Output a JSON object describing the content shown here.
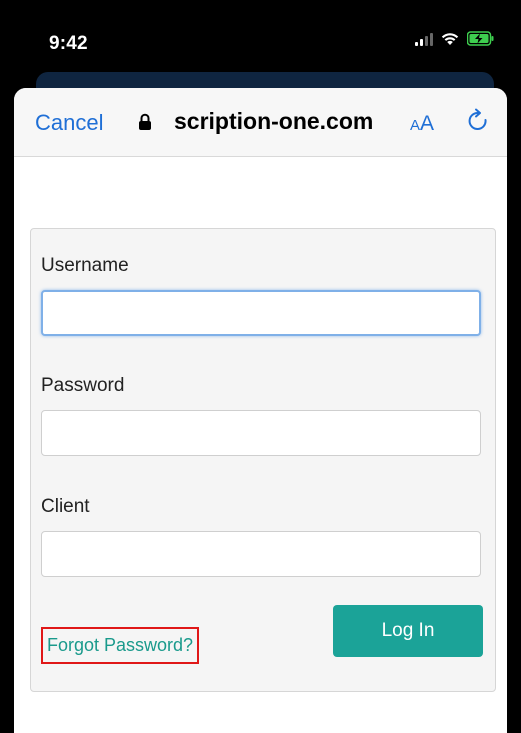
{
  "status_bar": {
    "time": "9:42",
    "icons": [
      "cellular-signal-icon",
      "wifi-icon",
      "battery-charging-icon"
    ]
  },
  "browser": {
    "cancel_label": "Cancel",
    "url": "scription-one.com",
    "aa_label_small": "A",
    "aa_label_large": "A",
    "lock_icon": "lock-icon",
    "reload_icon": "reload-icon"
  },
  "login_form": {
    "username_label": "Username",
    "username_value": "",
    "password_label": "Password",
    "password_value": "",
    "client_label": "Client",
    "client_value": "",
    "forgot_label": "Forgot Password?",
    "login_label": "Log In"
  },
  "colors": {
    "link_blue": "#1f6fd6",
    "teal": "#1ba398",
    "highlight_red": "#e01818"
  }
}
